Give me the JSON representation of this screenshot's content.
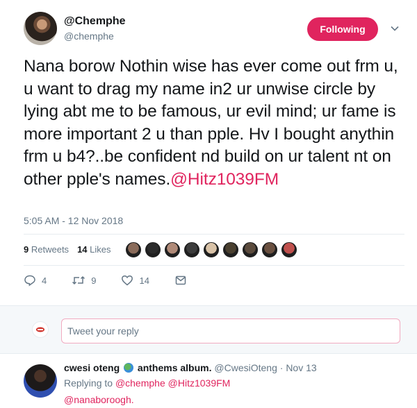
{
  "tweet": {
    "display_name": "@Chemphe",
    "handle": "@chemphe",
    "follow_button_label": "Following",
    "text": "Nana borow Nothin wise has ever come out frm u, u want to drag my name in2 ur unwise circle by lying abt me to be famous, ur evil mind; ur fame is more important 2 u than pple. Hv I bought anythin frm u b4?..be confident nd build on ur talent nt on other pple's names.",
    "mention": "@Hitz1039FM",
    "timestamp": "5:05 AM - 12 Nov 2018",
    "retweets_count": "9",
    "retweets_label": "Retweets",
    "likes_count": "14",
    "likes_label": "Likes",
    "likers": [
      "#8a6b5a",
      "#2b2b2b",
      "#b08a78",
      "#3c3c3c",
      "#d9c3a8",
      "#4a4030",
      "#5b4b3d",
      "#6a5040",
      "#c0504d"
    ],
    "actions": {
      "reply_count": "4",
      "retweet_count": "9",
      "like_count": "14"
    },
    "accent_color": "#e0245e"
  },
  "reply_box": {
    "placeholder": "Tweet your reply"
  },
  "reply": {
    "display_name": "cwesi oteng",
    "name_suffix": "anthems album.",
    "handle": "@CwesiOteng",
    "date": "· Nov 13",
    "replying_label": "Replying to",
    "replying_to": "@chemphe @Hitz1039FM",
    "text": "@nanaboroogh."
  }
}
